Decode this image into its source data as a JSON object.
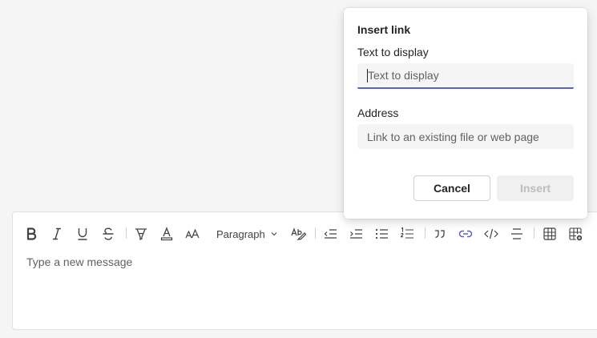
{
  "composer": {
    "paragraph_label": "Paragraph",
    "placeholder": "Type a new message",
    "toolbar_icons": [
      "bold-icon",
      "italic-icon",
      "underline-icon",
      "strikethrough-icon",
      "highlight-icon",
      "font-color-icon",
      "font-size-icon",
      "spellcheck-icon",
      "decrease-indent-icon",
      "increase-indent-icon",
      "bulleted-list-icon",
      "numbered-list-icon",
      "quote-icon",
      "link-icon",
      "code-icon",
      "horizontal-rule-icon",
      "table-icon",
      "insert-table-icon"
    ]
  },
  "dialog": {
    "title": "Insert link",
    "text_label": "Text to display",
    "text_placeholder": "Text to display",
    "address_label": "Address",
    "address_placeholder": "Link to an existing file or web page",
    "cancel_label": "Cancel",
    "insert_label": "Insert"
  },
  "colors": {
    "accent": "#5b5fc7",
    "background": "#f5f5f5"
  }
}
